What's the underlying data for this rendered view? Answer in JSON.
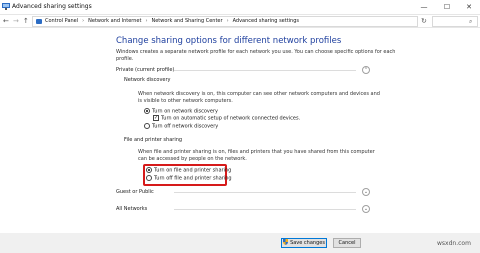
{
  "window": {
    "title": "Advanced sharing settings",
    "controls": {
      "minimize": "—",
      "maximize": "☐",
      "close": "✕"
    }
  },
  "addressbar": {
    "back": "←",
    "forward": "→",
    "up": "↑",
    "breadcrumbs": [
      "Control Panel",
      "Network and Internet",
      "Network and Sharing Center",
      "Advanced sharing settings"
    ],
    "separator": "›",
    "refresh": "↻",
    "search_icon": "⌕"
  },
  "main": {
    "heading": "Change sharing options for different network profiles",
    "intro": "Windows creates a separate network profile for each network you use. You can choose specific options for each profile.",
    "private_section": {
      "title": "Private (current profile)",
      "chevron": "⌃",
      "network_discovery": {
        "title": "Network discovery",
        "description": "When network discovery is on, this computer can see other network computers and devices and is visible to other network computers.",
        "options": [
          "Turn on network discovery",
          "Turn on automatic setup of network connected devices.",
          "Turn off network discovery"
        ],
        "selected": "Turn on network discovery",
        "checkbox_checked": true
      },
      "file_printer_sharing": {
        "title": "File and printer sharing",
        "description": "When file and printer sharing is on, files and printers that you have shared from this computer can be accessed by people on the network.",
        "options": [
          "Turn on file and printer sharing",
          "Turn off file and printer sharing"
        ],
        "selected": "Turn on file and printer sharing",
        "highlight_color": "#d61a1a"
      }
    },
    "guest_section": {
      "title": "Guest or Public",
      "chevron": "⌄"
    },
    "all_section": {
      "title": "All Networks",
      "chevron": "⌄"
    }
  },
  "footer": {
    "save_label": "Save changes",
    "cancel_label": "Cancel",
    "watermark": "wsxdn.com"
  },
  "colors": {
    "heading": "#1e3f9e",
    "highlight": "#d61a1a",
    "accent": "#0078d7"
  }
}
